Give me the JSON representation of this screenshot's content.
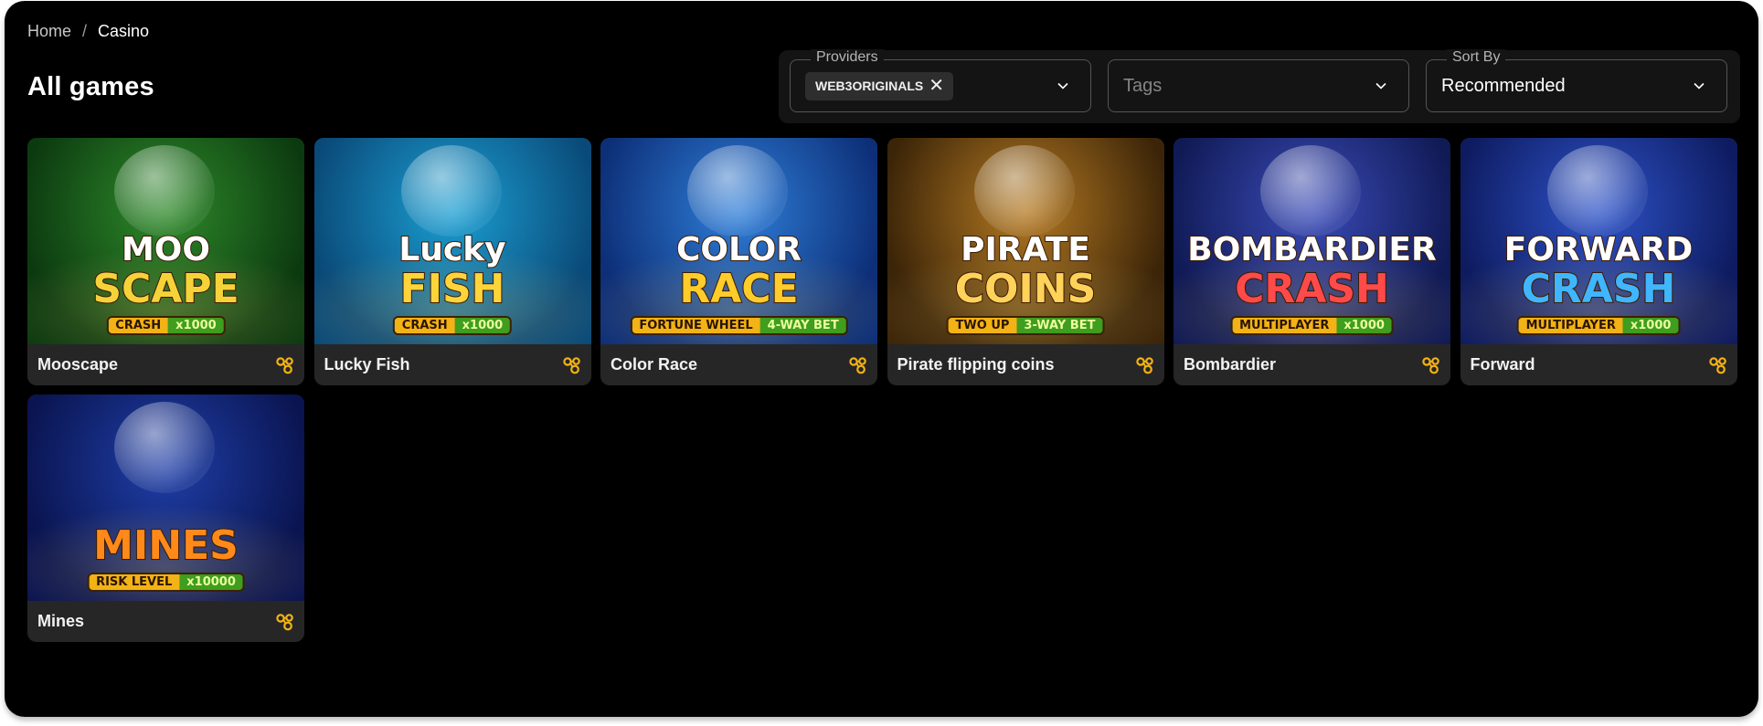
{
  "breadcrumb": {
    "home": "Home",
    "separator": "/",
    "current": "Casino"
  },
  "page_title": "All games",
  "filters": {
    "providers": {
      "legend": "Providers",
      "chip": "WEB3ORIGINALS",
      "chip_remove_icon": "close-icon"
    },
    "tags": {
      "placeholder": "Tags"
    },
    "sort": {
      "legend": "Sort By",
      "value": "Recommended"
    }
  },
  "games": [
    {
      "name": "Mooscape",
      "logo1": "MOO",
      "logo2": "SCAPE",
      "tag_a": "CRASH",
      "tag_b": "x1000",
      "bg": "#2e8a2a",
      "bg2": "#0c3a10",
      "logo_color": "#f6d23a",
      "provider_icon": "provider-link-icon"
    },
    {
      "name": "Lucky Fish",
      "logo1": "Lucky",
      "logo2": "FISH",
      "tag_a": "CRASH",
      "tag_b": "x1000",
      "bg": "#1b9fd3",
      "bg2": "#0a4a78",
      "logo_color": "#ffd43a",
      "provider_icon": "provider-link-icon"
    },
    {
      "name": "Color Race",
      "logo1": "COLOR",
      "logo2": "RACE",
      "tag_a": "FORTUNE WHEEL",
      "tag_b": "4-WAY BET",
      "bg": "#2f7fd9",
      "bg2": "#0d2f78",
      "logo_color": "#ffcc2a",
      "provider_icon": "provider-link-icon"
    },
    {
      "name": "Pirate flipping coins",
      "logo1": "PIRATE",
      "logo2": "COINS",
      "tag_a": "TWO UP",
      "tag_b": "3-WAY BET",
      "bg": "#b57a22",
      "bg2": "#3b2408",
      "logo_color": "#ffd25a",
      "provider_icon": "provider-link-icon"
    },
    {
      "name": "Bombardier",
      "logo1": "BOMBARDIER",
      "logo2": "CRASH",
      "tag_a": "MULTIPLAYER",
      "tag_b": "x1000",
      "bg": "#3a4bb8",
      "bg2": "#101a55",
      "logo_color": "#ff4a4a",
      "provider_icon": "provider-link-icon"
    },
    {
      "name": "Forward",
      "logo1": "FORWARD",
      "logo2": "CRASH",
      "tag_a": "MULTIPLAYER",
      "tag_b": "x1000",
      "bg": "#2d53c9",
      "bg2": "#0e1b60",
      "logo_color": "#3fb6ff",
      "provider_icon": "provider-link-icon"
    },
    {
      "name": "Mines",
      "logo1": "",
      "logo2": "MINES",
      "tag_a": "RISK LEVEL",
      "tag_b": "x10000",
      "bg": "#1f3fa8",
      "bg2": "#0a1450",
      "logo_color": "#ff8a1a",
      "provider_icon": "provider-link-icon"
    }
  ],
  "colors": {
    "accent": "#f3b215",
    "background": "#000000",
    "card": "#262626"
  }
}
